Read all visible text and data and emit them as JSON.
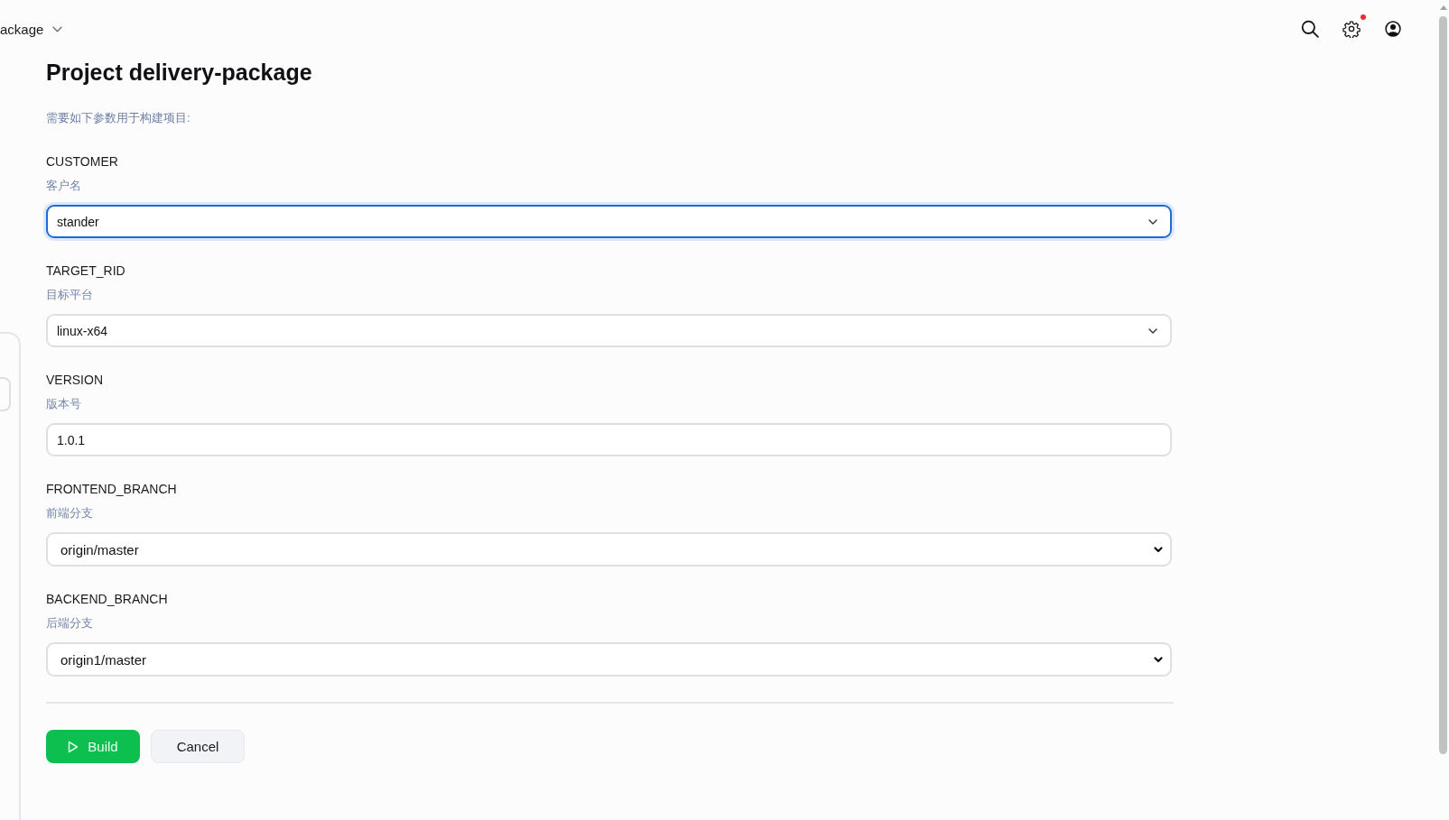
{
  "header": {
    "breadcrumb": "ackage",
    "settings_alert": true
  },
  "form": {
    "title": "Project delivery-package",
    "description": "需要如下参数用于构建项目:",
    "parameters": [
      {
        "name": "CUSTOMER",
        "description": "客户名",
        "kind": "select",
        "value": "stander",
        "focused": true
      },
      {
        "name": "TARGET_RID",
        "description": "目标平台",
        "kind": "select",
        "value": "linux-x64",
        "focused": false
      },
      {
        "name": "VERSION",
        "description": "版本号",
        "kind": "text",
        "value": "1.0.1",
        "focused": false
      },
      {
        "name": "FRONTEND_BRANCH",
        "description": "前端分支",
        "kind": "native",
        "value": "origin/master",
        "focused": false
      },
      {
        "name": "BACKEND_BRANCH",
        "description": "后端分支",
        "kind": "native",
        "value": "origin1/master",
        "focused": false
      }
    ]
  },
  "buttons": [
    {
      "label": "Build",
      "kind": "primary"
    },
    {
      "label": "Cancel",
      "kind": "secondary"
    }
  ]
}
